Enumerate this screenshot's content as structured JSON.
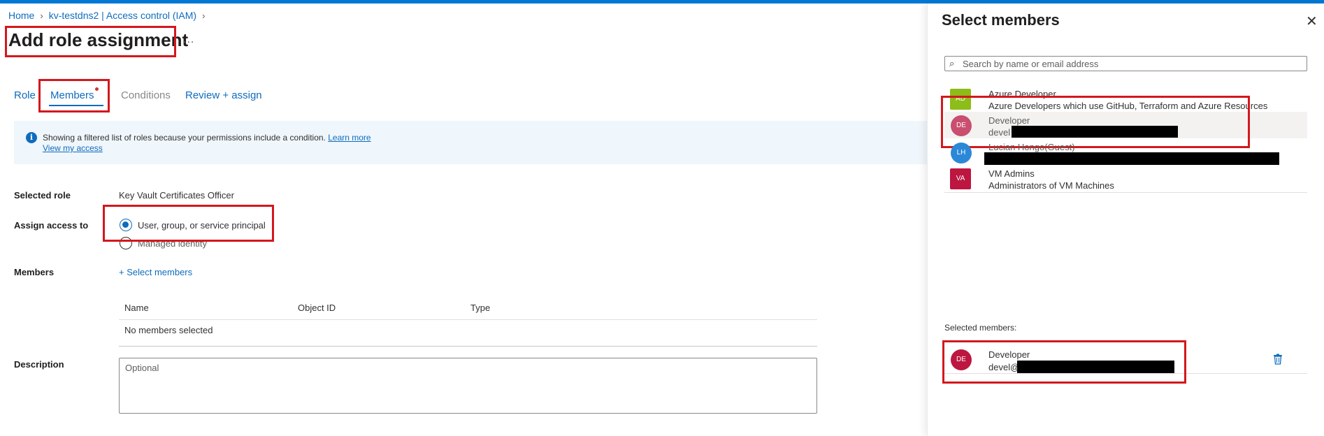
{
  "breadcrumb": {
    "home": "Home",
    "resource": "kv-testdns2 | Access control (IAM)"
  },
  "page": {
    "title": "Add role assignment",
    "more": "..."
  },
  "tabs": {
    "role": "Role",
    "members": "Members",
    "conditions": "Conditions",
    "review": "Review + assign"
  },
  "info": {
    "text": "Showing a filtered list of roles because your permissions include a condition.",
    "learn_more": "Learn more",
    "view_access": "View my access"
  },
  "form": {
    "selected_role_label": "Selected role",
    "selected_role_value": "Key Vault Certificates Officer",
    "assign_label": "Assign access to",
    "option_principal": "User, group, or service principal",
    "option_identity": "Managed identity",
    "members_label": "Members",
    "select_members": "+ Select members",
    "table_headers": [
      "Name",
      "Object ID",
      "Type"
    ],
    "no_members": "No members selected",
    "description_label": "Description",
    "description_placeholder": "Optional"
  },
  "panel": {
    "title": "Select members",
    "close": "✕",
    "search_placeholder": "Search by name or email address",
    "results": [
      {
        "initials": "AD",
        "name": "Azure Developer",
        "sub": "Azure Developers which use GitHub, Terraform and Azure Resources",
        "color": "#8cbd18"
      },
      {
        "initials": "DE",
        "name": "Developer",
        "sub": "devel",
        "color": "#c94e6f"
      },
      {
        "initials": "LH",
        "name": "Lucian Hongo(Guest)",
        "sub": "",
        "color": "#2b88d8"
      },
      {
        "initials": "VA",
        "name": "VM Admins",
        "sub": "Administrators of VM Machines",
        "color": "#bd1640"
      }
    ],
    "selected_label": "Selected members:",
    "selected": {
      "initials": "DE",
      "name": "Developer",
      "sub": "devel@",
      "color": "#bd1640"
    }
  },
  "colors": {
    "accent": "#0f6cbd",
    "highlight": "#d3181d"
  }
}
